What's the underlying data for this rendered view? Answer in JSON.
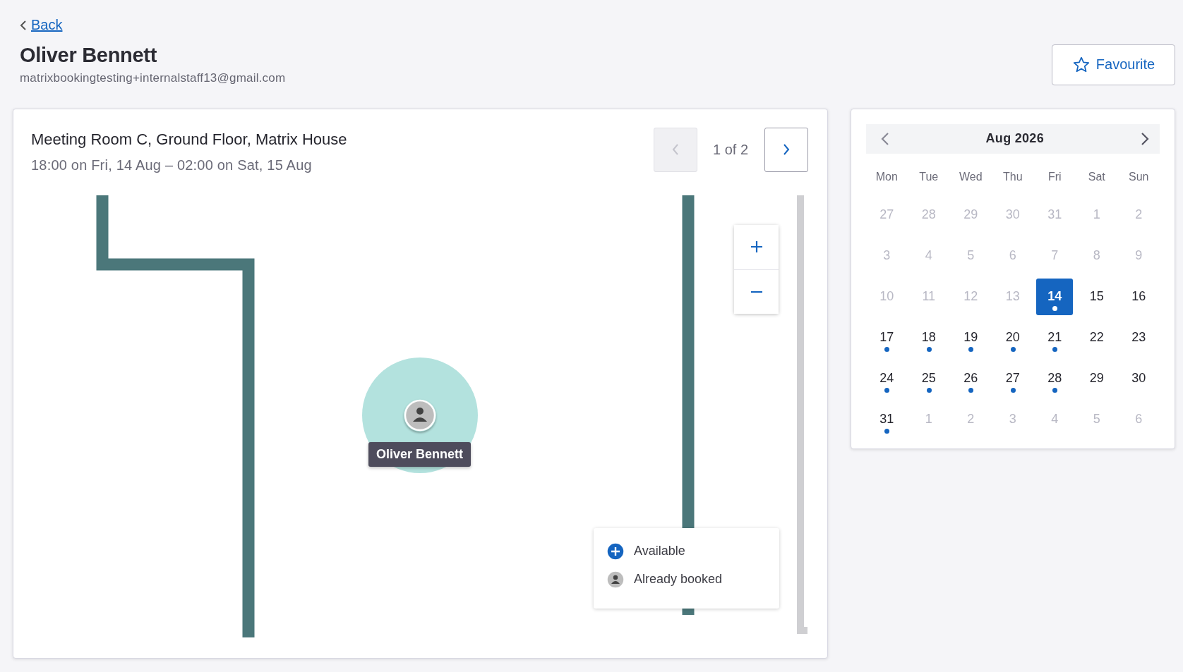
{
  "back_link": {
    "label": "Back"
  },
  "person": {
    "name": "Oliver Bennett",
    "email": "matrixbookingtesting+internalstaff13@gmail.com"
  },
  "favourite_button": {
    "label": "Favourite",
    "selected": false
  },
  "booking": {
    "title": "Meeting Room C, Ground Floor, Matrix House",
    "time": "18:00 on Fri, 14 Aug – 02:00 on Sat, 15 Aug",
    "pager": {
      "label": "1 of 2",
      "prev_disabled": true,
      "next_disabled": false
    }
  },
  "map": {
    "marker": {
      "label": "Oliver Bennett"
    },
    "legend": [
      {
        "kind": "available",
        "label": "Available"
      },
      {
        "kind": "booked",
        "label": "Already booked"
      }
    ]
  },
  "calendar": {
    "month": "Aug 2026",
    "weekdays": [
      "Mon",
      "Tue",
      "Wed",
      "Thu",
      "Fri",
      "Sat",
      "Sun"
    ],
    "weeks": [
      [
        {
          "label": "27",
          "disabled": true,
          "selected": false,
          "booked": false
        },
        {
          "label": "28",
          "disabled": true,
          "selected": false,
          "booked": false
        },
        {
          "label": "29",
          "disabled": true,
          "selected": false,
          "booked": false
        },
        {
          "label": "30",
          "disabled": true,
          "selected": false,
          "booked": false
        },
        {
          "label": "31",
          "disabled": true,
          "selected": false,
          "booked": false
        },
        {
          "label": "1",
          "disabled": true,
          "selected": false,
          "booked": false
        },
        {
          "label": "2",
          "disabled": true,
          "selected": false,
          "booked": false
        }
      ],
      [
        {
          "label": "3",
          "disabled": true,
          "selected": false,
          "booked": false
        },
        {
          "label": "4",
          "disabled": true,
          "selected": false,
          "booked": false
        },
        {
          "label": "5",
          "disabled": true,
          "selected": false,
          "booked": false
        },
        {
          "label": "6",
          "disabled": true,
          "selected": false,
          "booked": false
        },
        {
          "label": "7",
          "disabled": true,
          "selected": false,
          "booked": false
        },
        {
          "label": "8",
          "disabled": true,
          "selected": false,
          "booked": false
        },
        {
          "label": "9",
          "disabled": true,
          "selected": false,
          "booked": false
        }
      ],
      [
        {
          "label": "10",
          "disabled": true,
          "selected": false,
          "booked": false
        },
        {
          "label": "11",
          "disabled": true,
          "selected": false,
          "booked": false
        },
        {
          "label": "12",
          "disabled": true,
          "selected": false,
          "booked": false
        },
        {
          "label": "13",
          "disabled": true,
          "selected": false,
          "booked": false
        },
        {
          "label": "14",
          "disabled": false,
          "selected": true,
          "booked": true
        },
        {
          "label": "15",
          "disabled": false,
          "selected": false,
          "booked": false
        },
        {
          "label": "16",
          "disabled": false,
          "selected": false,
          "booked": false
        }
      ],
      [
        {
          "label": "17",
          "disabled": false,
          "selected": false,
          "booked": true
        },
        {
          "label": "18",
          "disabled": false,
          "selected": false,
          "booked": true
        },
        {
          "label": "19",
          "disabled": false,
          "selected": false,
          "booked": true
        },
        {
          "label": "20",
          "disabled": false,
          "selected": false,
          "booked": true
        },
        {
          "label": "21",
          "disabled": false,
          "selected": false,
          "booked": true
        },
        {
          "label": "22",
          "disabled": false,
          "selected": false,
          "booked": false
        },
        {
          "label": "23",
          "disabled": false,
          "selected": false,
          "booked": false
        }
      ],
      [
        {
          "label": "24",
          "disabled": false,
          "selected": false,
          "booked": true
        },
        {
          "label": "25",
          "disabled": false,
          "selected": false,
          "booked": true
        },
        {
          "label": "26",
          "disabled": false,
          "selected": false,
          "booked": true
        },
        {
          "label": "27",
          "disabled": false,
          "selected": false,
          "booked": true
        },
        {
          "label": "28",
          "disabled": false,
          "selected": false,
          "booked": true
        },
        {
          "label": "29",
          "disabled": false,
          "selected": false,
          "booked": false
        },
        {
          "label": "30",
          "disabled": false,
          "selected": false,
          "booked": false
        }
      ],
      [
        {
          "label": "31",
          "disabled": false,
          "selected": false,
          "booked": true
        },
        {
          "label": "1",
          "disabled": true,
          "selected": false,
          "booked": false
        },
        {
          "label": "2",
          "disabled": true,
          "selected": false,
          "booked": false
        },
        {
          "label": "3",
          "disabled": true,
          "selected": false,
          "booked": false
        },
        {
          "label": "4",
          "disabled": true,
          "selected": false,
          "booked": false
        },
        {
          "label": "5",
          "disabled": true,
          "selected": false,
          "booked": false
        },
        {
          "label": "6",
          "disabled": true,
          "selected": false,
          "booked": false
        }
      ]
    ]
  }
}
